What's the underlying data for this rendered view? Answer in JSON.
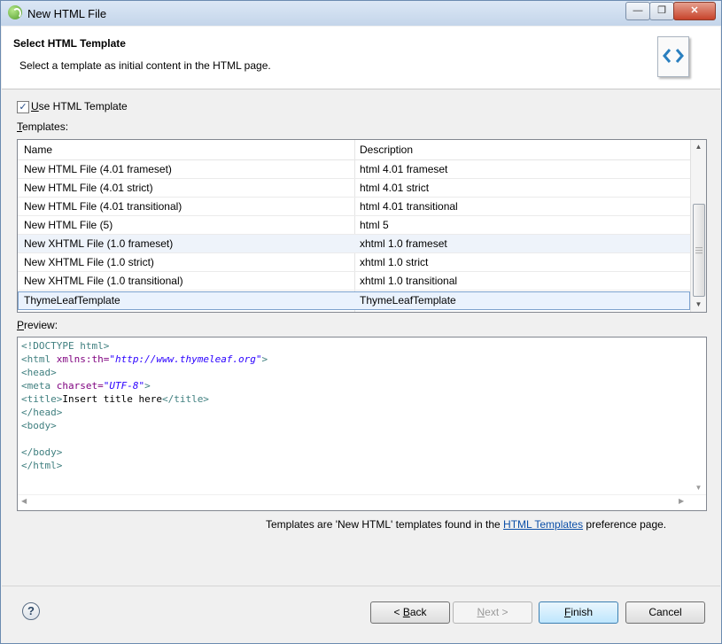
{
  "window": {
    "title": "New HTML File",
    "minimize_glyph": "—",
    "maximize_glyph": "❐",
    "close_glyph": "✕"
  },
  "banner": {
    "title": "Select HTML Template",
    "description": "Select a template as initial content in the HTML page.",
    "icon": "html-tag-icon"
  },
  "use_template": {
    "checked": true,
    "check_glyph": "✓",
    "label_accel": "U",
    "label_rest": "se HTML Template"
  },
  "templates_label": {
    "accel": "T",
    "rest": "emplates:"
  },
  "table": {
    "columns": [
      "Name",
      "Description"
    ],
    "rows": [
      {
        "name": "New HTML File (4.01 frameset)",
        "description": "html 4.01 frameset"
      },
      {
        "name": "New HTML File (4.01 strict)",
        "description": "html 4.01 strict"
      },
      {
        "name": "New HTML File (4.01 transitional)",
        "description": "html 4.01 transitional"
      },
      {
        "name": "New HTML File (5)",
        "description": "html 5"
      },
      {
        "name": "New XHTML File (1.0 frameset)",
        "description": "xhtml 1.0 frameset"
      },
      {
        "name": "New XHTML File (1.0 strict)",
        "description": "xhtml 1.0 strict"
      },
      {
        "name": "New XHTML File (1.0 transitional)",
        "description": "xhtml 1.0 transitional"
      },
      {
        "name": "ThymeLeafTemplate",
        "description": "ThymeLeafTemplate"
      }
    ],
    "selected_row": "ThymeLeafTemplate"
  },
  "preview_label": {
    "accel": "P",
    "rest": "review:"
  },
  "preview": {
    "doctype": "<!DOCTYPE html>",
    "html_open": "<html",
    "xmlns_attr": " xmlns:th=",
    "xmlns_value": "\"http://www.thymeleaf.org\"",
    "html_close_bracket": ">",
    "head_open": "<head>",
    "meta_open": "<meta",
    "charset_attr": " charset=",
    "charset_value": "\"UTF-8\"",
    "meta_close": ">",
    "title_open": "<title>",
    "title_text": "Insert title here",
    "title_close": "</title>",
    "head_close": "</head>",
    "body_open": "<body>",
    "body_close": "</body>",
    "html_close": "</html>"
  },
  "footnote": {
    "prefix": "Templates are 'New HTML' templates found in the ",
    "link": "HTML Templates",
    "suffix": " preference page."
  },
  "buttons": {
    "help": "?",
    "back_prefix": "< ",
    "back_accel": "B",
    "back_rest": "ack",
    "next_accel": "N",
    "next_rest": "ext >",
    "finish_accel": "F",
    "finish_rest": "inish",
    "cancel": "Cancel"
  }
}
